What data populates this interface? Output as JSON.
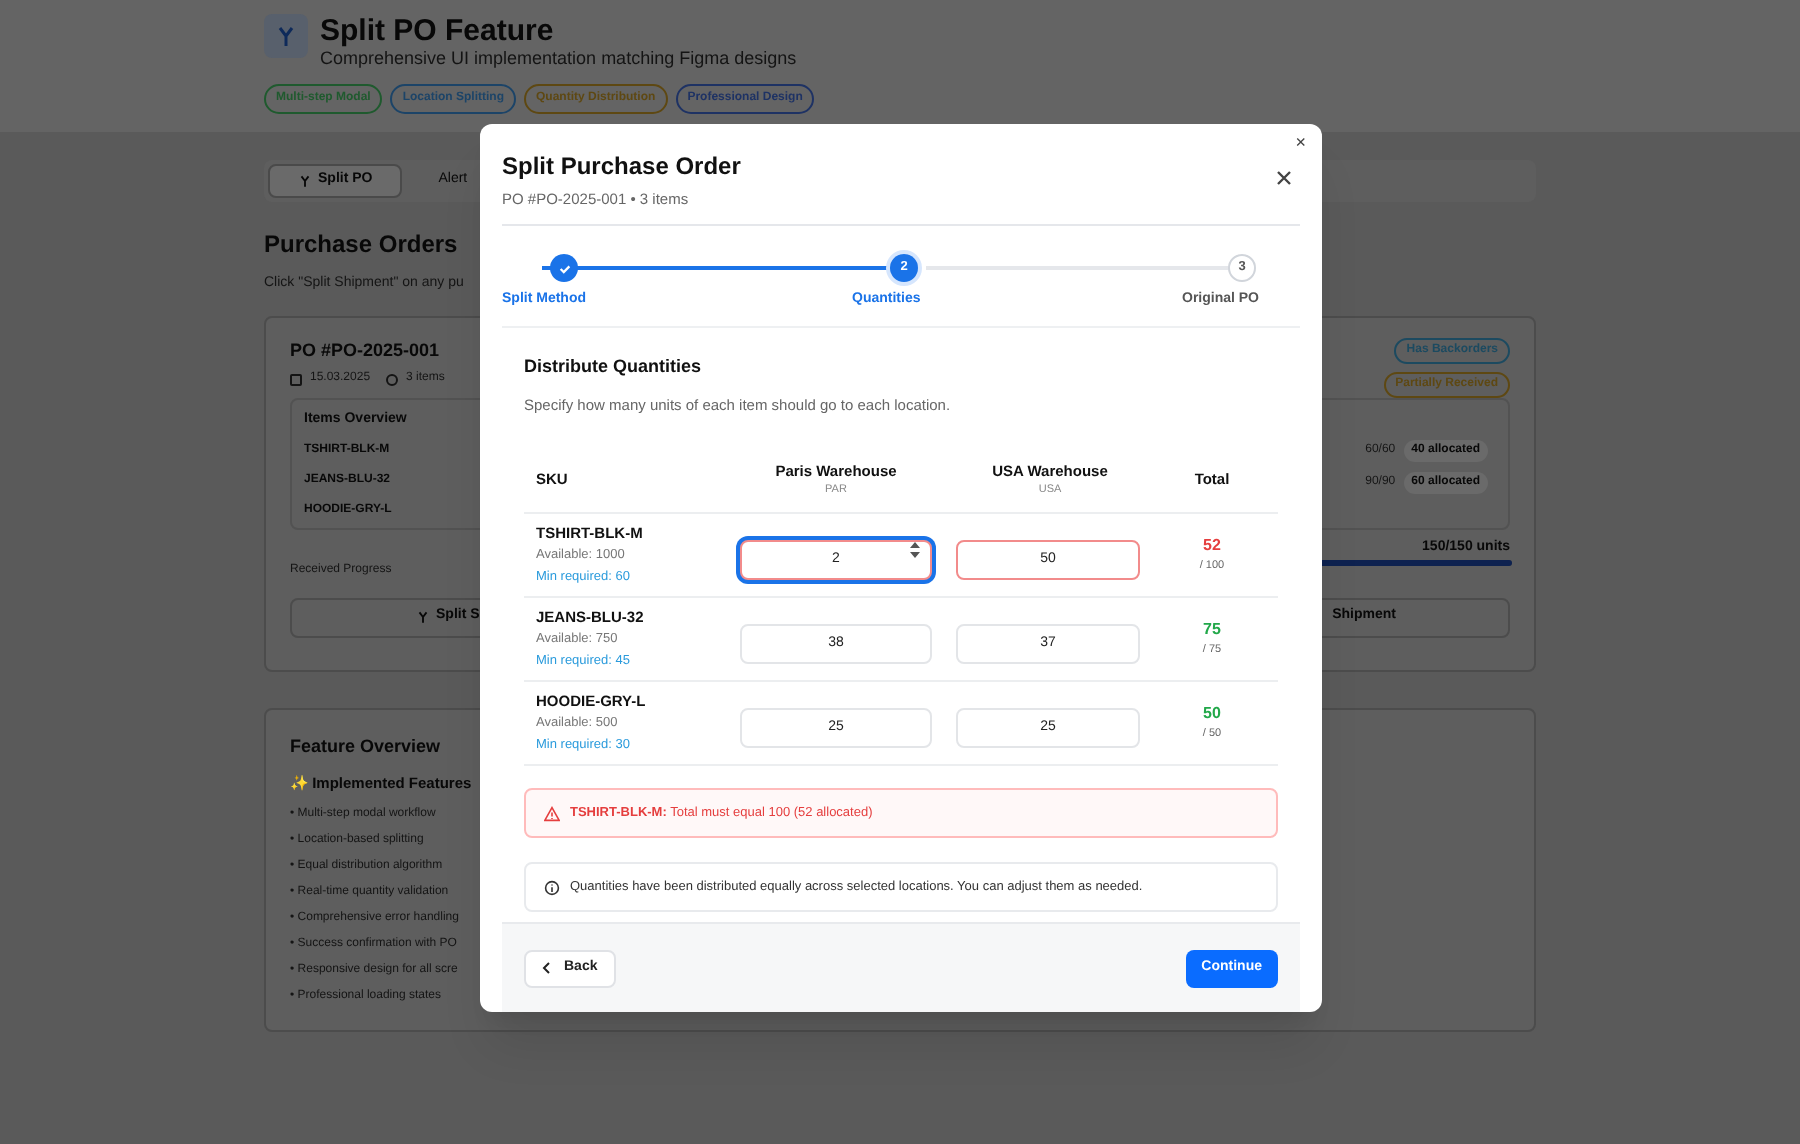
{
  "header": {
    "title": "Split PO Feature",
    "subtitle": "Comprehensive UI implementation matching Figma designs",
    "tags": [
      {
        "label": "Multi-step Modal",
        "color": "#1f5a2e"
      },
      {
        "label": "Location Splitting",
        "color": "#1c4468"
      },
      {
        "label": "Quantity Distribution",
        "color": "#5e4812"
      },
      {
        "label": "Professional Design",
        "color": "#1e3264"
      }
    ]
  },
  "tabs": [
    {
      "label": "Split PO",
      "selected": true
    },
    {
      "label": "Alert",
      "selected": false
    }
  ],
  "section": {
    "title": "Purchase Orders",
    "hint": "Click \"Split Shipment\" on any pu"
  },
  "po_card": {
    "title": "PO #PO-2025-001",
    "date": "15.03.2025",
    "items": "3 items",
    "badges": [
      {
        "label": "Has Backorders",
        "color": "#1c4a60"
      },
      {
        "label": "Partially Received",
        "color": "#5e4812"
      }
    ],
    "overview_title": "Items Overview",
    "skus": [
      "TSHIRT-BLK-M",
      "JEANS-BLU-32",
      "HOODIE-GRY-L"
    ],
    "allocations": [
      {
        "qty": "60/60",
        "allocated": "40 allocated"
      },
      {
        "qty": "90/90",
        "allocated": "60 allocated"
      }
    ],
    "progress_label": "Received Progress",
    "progress_value": "150/150 units",
    "level": 1,
    "button_left": "Split S",
    "button_right": "Shipment"
  },
  "feature_card": {
    "title": "Feature Overview",
    "subtitle": "✨ Implemented Features",
    "items": [
      "• Multi-step modal workflow",
      "• Location-based splitting",
      "• Equal distribution algorithm",
      "• Real-time quantity validation",
      "• Comprehensive error handling",
      "• Success confirmation with PO",
      "• Responsive design for all scre",
      "• Professional loading states"
    ]
  },
  "modal": {
    "close_glyph": "×",
    "title": "Split Purchase Order",
    "subtitle": "PO #PO-2025-001 • 3 items",
    "steps": [
      {
        "label": "Split Method",
        "completed": true,
        "active": false
      },
      {
        "label": "Quantities",
        "completed": false,
        "active": true,
        "number": "2"
      },
      {
        "label": "Original PO",
        "completed": false,
        "active": false,
        "number": "3"
      }
    ],
    "heading": "Distribute Quantities",
    "description": "Specify how many units of each item should go to each location.",
    "columns": [
      {
        "name": "SKU"
      },
      {
        "name": "Paris Warehouse",
        "code": "PAR"
      },
      {
        "name": "USA Warehouse",
        "code": "USA"
      },
      {
        "name": "Total"
      }
    ],
    "rows": [
      {
        "sku": "TSHIRT-BLK-M",
        "available": "Available: 1000",
        "min": "Min required: 60",
        "values": [
          {
            "value": "2",
            "focused": true,
            "error": true
          },
          {
            "value": "50",
            "focused": false,
            "error": true
          }
        ],
        "total": "52",
        "required": "/ 100",
        "valid": false
      },
      {
        "sku": "JEANS-BLU-32",
        "available": "Available: 750",
        "min": "Min required: 45",
        "values": [
          {
            "value": "38",
            "focused": false,
            "error": false
          },
          {
            "value": "37",
            "focused": false,
            "error": false
          }
        ],
        "total": "75",
        "required": "/ 75",
        "valid": true
      },
      {
        "sku": "HOODIE-GRY-L",
        "available": "Available: 500",
        "min": "Min required: 30",
        "values": [
          {
            "value": "25",
            "focused": false,
            "error": false
          },
          {
            "value": "25",
            "focused": false,
            "error": false
          }
        ],
        "total": "50",
        "required": "/ 50",
        "valid": true
      }
    ],
    "error": {
      "sku": "TSHIRT-BLK-M:",
      "message": "Total must equal 100 (52 allocated)"
    },
    "info": "Quantities have been distributed equally across selected locations. You can adjust them as needed.",
    "back": "Back",
    "continue": "Continue"
  }
}
